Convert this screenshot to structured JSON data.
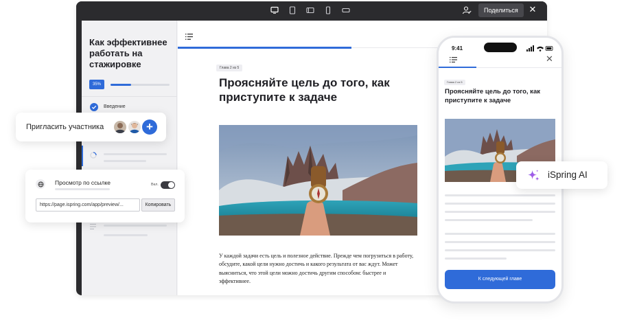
{
  "toolbar": {
    "device_icons": [
      "desktop-icon",
      "tablet-icon",
      "tablet-landscape-icon",
      "phone-icon",
      "phone-landscape-icon"
    ],
    "share_label": "Поделиться",
    "close": "✕"
  },
  "sidebar": {
    "course_title": "Как эффективнее работать на стажировке",
    "progress_label": "35%",
    "progress": 0.35,
    "items": [
      {
        "label": "Введение",
        "status": "completed"
      }
    ]
  },
  "lesson": {
    "chapter": "Глава 2 из 5",
    "title": "Проясняйте цель до того, как приступите к задаче",
    "body": "У каждой задачи есть цель и полезное действие. Прежде чем погрузиться в работу, обсудите, какой цели нужно достичь и какого результата от вас ждут. Может выясниться, что этой цели можно достичь другим способом: быстрее и эффективнее."
  },
  "phone": {
    "time": "9:41",
    "chapter": "Глава 2 из 5",
    "title": "Проясняйте цель до того, как приступите к задаче",
    "next_button": "К следующей главе"
  },
  "invite": {
    "label": "Пригласить участника",
    "add": "+"
  },
  "link_share": {
    "title": "Просмотр по ссылке",
    "toggle_label": "Вкл.",
    "toggle_on": true,
    "url": "https://page.ispring.com/app/preview/...",
    "copy_label": "Копировать"
  },
  "ai": {
    "label": "iSpring AI"
  },
  "colors": {
    "accent": "#2f6bd9",
    "window_bar": "#2b2b2e"
  }
}
